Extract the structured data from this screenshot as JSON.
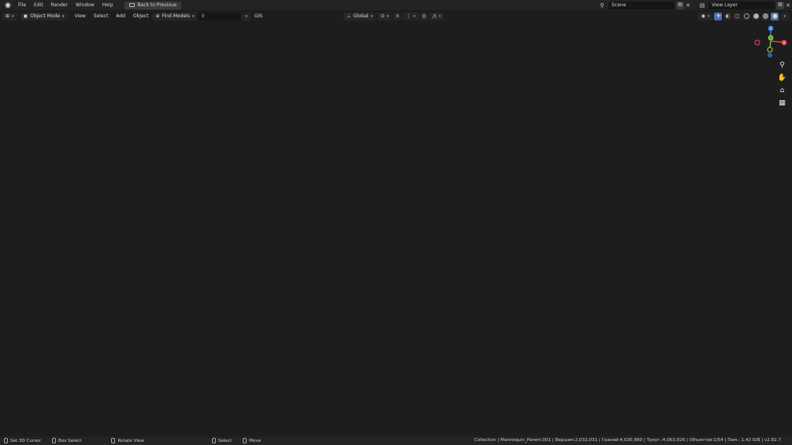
{
  "topbar": {
    "menus": [
      "File",
      "Edit",
      "Render",
      "Window",
      "Help"
    ],
    "back_button": "Back to Previous",
    "scene": "Scene",
    "view_layer": "View Layer"
  },
  "viewport_header": {
    "mode": "Object Mode",
    "menus": [
      "View",
      "Select",
      "Add",
      "Object"
    ],
    "find_models": "Find Models",
    "search_value": "",
    "gis": "GIS",
    "orientation": "Global"
  },
  "gizmo": {
    "axis_z": "Z",
    "axis_y": "Y",
    "axis_x": "X"
  },
  "statusbar": {
    "set_cursor": "Set 3D Cursor",
    "box_select": "Box Select",
    "rotate_view": "Rotate View",
    "select": "Select",
    "move": "Move",
    "stats": "Collection | Mannequin_Parent.001 | Вершин:2,032,031 | Граней:4,030,980 | Треуг.:4,063,026 | Объектов:1/54 | Пам.: 1.43 GiB | v2.82.7"
  },
  "colors": {
    "ui_bg": "#232323",
    "accent": "#4772b3",
    "axis_x": "#e0404f",
    "axis_y": "#86c540",
    "axis_z": "#3f7fe0"
  }
}
